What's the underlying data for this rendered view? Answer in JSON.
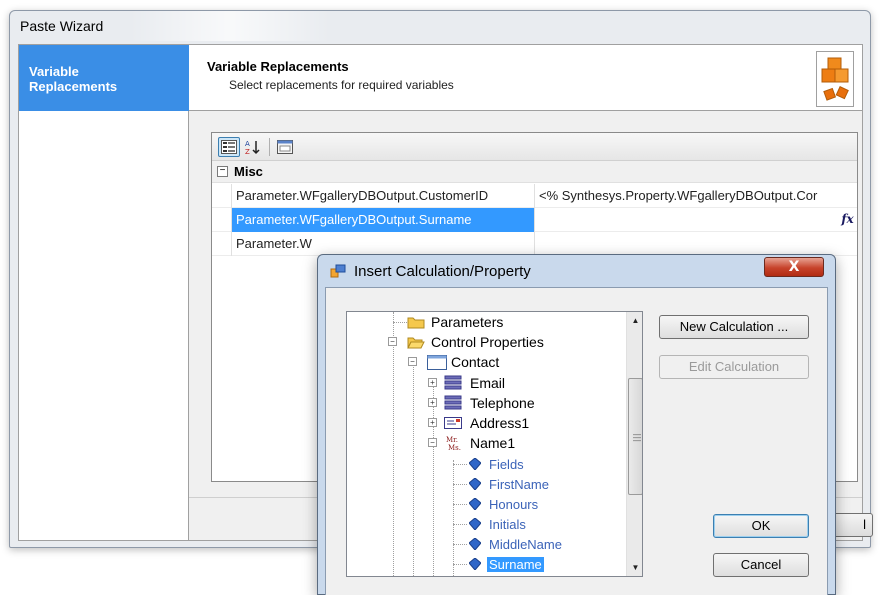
{
  "wizard": {
    "title": "Paste Wizard",
    "steps": [
      {
        "label": "Variable Replacements",
        "active": true
      }
    ],
    "header": {
      "title": "Variable Replacements",
      "subtitle": "Select replacements for required variables"
    },
    "grid": {
      "category": "Misc",
      "rows": [
        {
          "name": "Parameter.WFgalleryDBOutput.CustomerID",
          "value": "<% Synthesys.Property.WFgalleryDBOutput.Cor",
          "selected": false
        },
        {
          "name": "Parameter.WFgalleryDBOutput.Surname",
          "value": "",
          "selected": true
        },
        {
          "name": "Parameter.W",
          "value": "",
          "selected": false
        }
      ],
      "fx_label": "fx"
    },
    "partial_button_label": "l"
  },
  "dialog": {
    "title": "Insert Calculation/Property",
    "close_label": "X",
    "tree": [
      {
        "label": "Parameters",
        "icon": "folder-icon",
        "expander": ""
      },
      {
        "label": "Control Properties",
        "icon": "folder-open-icon",
        "expander": "−"
      },
      {
        "label": "Contact",
        "icon": "form-icon",
        "expander": "−"
      },
      {
        "label": "Email",
        "icon": "textbox-icon",
        "expander": "+"
      },
      {
        "label": "Telephone",
        "icon": "textbox-icon",
        "expander": "+"
      },
      {
        "label": "Address1",
        "icon": "address-icon",
        "expander": "+"
      },
      {
        "label": "Name1",
        "icon": "name-control-icon",
        "expander": "−"
      },
      {
        "label": "Fields",
        "icon": "property-icon"
      },
      {
        "label": "FirstName",
        "icon": "property-icon"
      },
      {
        "label": "Honours",
        "icon": "property-icon"
      },
      {
        "label": "Initials",
        "icon": "property-icon"
      },
      {
        "label": "MiddleName",
        "icon": "property-icon"
      },
      {
        "label": "Surname",
        "icon": "property-icon",
        "selected": true
      }
    ],
    "buttons": {
      "new_calculation": "New Calculation ...",
      "edit_calculation": "Edit Calculation",
      "ok": "OK",
      "cancel": "Cancel"
    }
  },
  "colors": {
    "selection": "#3399ff",
    "wizard_step_active": "#3a8ee6",
    "leaf_text": "#3b63b8",
    "close_button": "#c7432b"
  }
}
